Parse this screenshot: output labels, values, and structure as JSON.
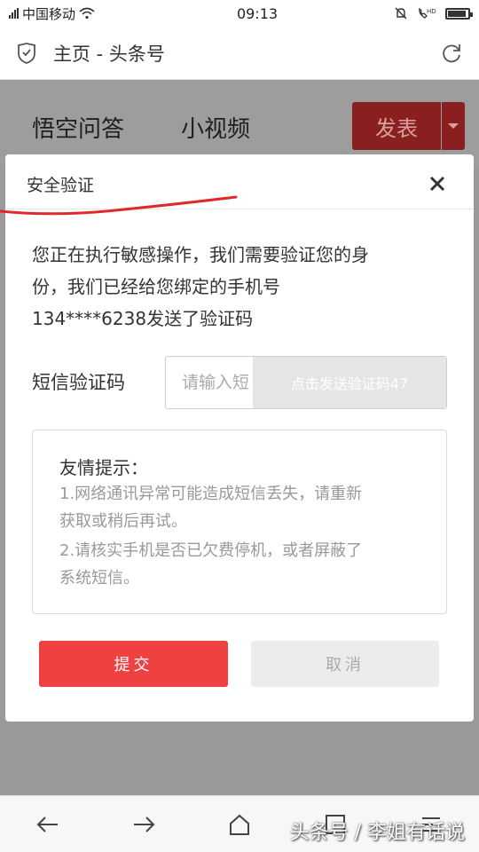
{
  "status_bar": {
    "carrier": "中国移动",
    "time": "09:13"
  },
  "browser": {
    "title": "主页 - 头条号"
  },
  "page": {
    "tabs": [
      "悟空问答",
      "小视频"
    ],
    "publish_label": "发表"
  },
  "modal": {
    "title": "安全验证",
    "message_lines": [
      "您正在执行敏感操作，我们需要验证您的身",
      "份，我们已经给您绑定的手机号",
      "134****6238发送了验证码"
    ],
    "sms_label": "短信验证码",
    "sms_placeholder": "请输入短",
    "send_code_label": "点击发送验证码47",
    "tips_title": "友情提示：",
    "tips_lines": [
      "1.网络通讯异常可能造成短信丢失，请重新",
      "获取或稍后再试。",
      "2.请核实手机是否已欠费停机，或者屏蔽了",
      "系统短信。"
    ],
    "submit_label": "提交",
    "cancel_label": "取消"
  },
  "bottom_nav": {
    "icons": [
      "back-arrow-icon",
      "forward-arrow-icon",
      "home-icon",
      "tabs-icon",
      "menu-icon"
    ]
  },
  "watermark": "头条号 / 李姐有话说",
  "colors": {
    "accent_red": "#f04142",
    "overlay_gray": "#9a9a9a"
  }
}
